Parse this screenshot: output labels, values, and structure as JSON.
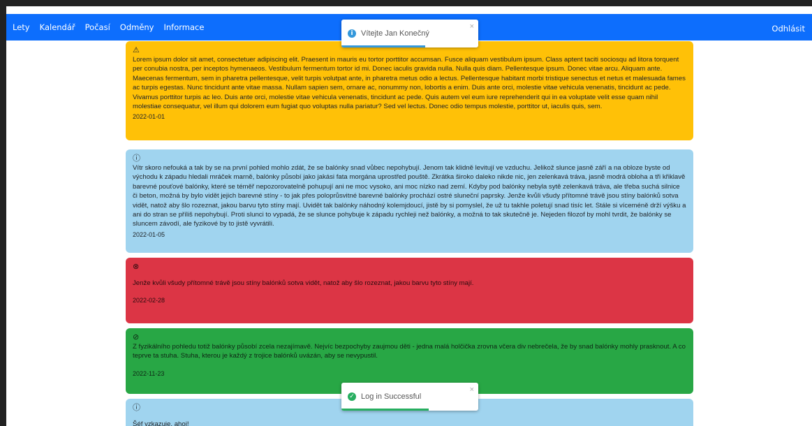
{
  "navbar": {
    "links": [
      "Lety",
      "Kalendář",
      "Počasí",
      "Odměny",
      "Informace"
    ],
    "logout": "Odhlásit",
    "bg": "#0d6efd"
  },
  "notices": [
    {
      "type": "warning",
      "icon": "⚠",
      "text": "Lorem ipsum dolor sit amet, consectetuer adipiscing elit. Praesent in mauris eu tortor porttitor accumsan. Fusce aliquam vestibulum ipsum. Class aptent taciti sociosqu ad litora torquent per conubia nostra, per inceptos hymenaeos. Vestibulum fermentum tortor id mi. Donec iaculis gravida nulla. Nulla quis diam. Pellentesque ipsum. Donec vitae arcu. Aliquam ante. Maecenas fermentum, sem in pharetra pellentesque, velit turpis volutpat ante, in pharetra metus odio a lectus. Pellentesque habitant morbi tristique senectus et netus et malesuada fames ac turpis egestas. Nunc tincidunt ante vitae massa. Nullam sapien sem, ornare ac, nonummy non, lobortis a enim. Duis ante orci, molestie vitae vehicula venenatis, tincidunt ac pede. Vivamus porttitor turpis ac leo. Duis ante orci, molestie vitae vehicula venenatis, tincidunt ac pede. Quis autem vel eum iure reprehenderit qui in ea voluptate velit esse quam nihil molestiae consequatur, vel illum qui dolorem eum fugiat quo voluptas nulla pariatur? Sed vel lectus. Donec odio tempus molestie, porttitor ut, iaculis quis, sem.",
      "date": "2022-01-01"
    },
    {
      "type": "info",
      "icon": "ⓘ",
      "text": "Vítr skoro nefouká a tak by se na první pohled mohlo zdát, že se balónky snad vůbec nepohybují. Jenom tak klidně levitují ve vzduchu. Jelikož slunce jasně září a na obloze byste od východu k západu hledali mráček marně, balónky působí jako jakási fata morgána uprostřed pouště. Zkrátka široko daleko nikde nic, jen zelenkavá tráva, jasně modrá obloha a tři křiklavě barevné pouťové balónky, které se téměř nepozorovatelně pohupují ani ne moc vysoko, ani moc nízko nad zemí. Kdyby pod balónky nebyla sytě zelenkavá tráva, ale třeba suchá silnice či beton, možná by bylo vidět jejich barevné stíny - to jak přes poloprůsvitné barevné balónky prochází ostré sluneční paprsky. Jenže kvůli všudy přítomné trávě jsou stíny balónků sotva vidět, natož aby šlo rozeznat, jakou barvu tyto stíny mají. Uvidět tak balónky náhodný kolemjdoucí, jistě by si pomyslel, že už tu takhle poletují snad tisíc let. Stále si víceméně drží výšku a ani do stran se příliš nepohybují. Proti slunci to vypadá, že se slunce pohybuje k západu rychleji než balónky, a možná to tak skutečně je. Nejeden filozof by mohl tvrdit, že balónky se sluncem závodí, ale fyzikové by to jistě vyvrátili.",
      "date": "2022-01-05"
    },
    {
      "type": "danger",
      "icon": "⊗",
      "text": "Jenže kvůli všudy přítomné trávě jsou stíny balónků sotva vidět, natož aby šlo rozeznat, jakou barvu tyto stíny mají.",
      "date": "2022-02-28"
    },
    {
      "type": "success",
      "icon": "⊘",
      "text": "Z fyzikálního pohledu totiž balónky působí zcela nezajímavě. Nejvíc bezpochyby zaujmou děti - jedna malá holčička zrovna včera div nebrečela, že by snad balónky mohly prasknout. A co teprve ta stuha. Stuha, kterou je každý z trojice balónků uvázán, aby se nevypustil.",
      "date": "2022-11-23"
    },
    {
      "type": "info",
      "icon": "ⓘ",
      "text": "Šéf vzkazuje, ahoj!",
      "date": ""
    }
  ],
  "toasts": [
    {
      "icon": "i",
      "message": "Vítejte Jan Konečný",
      "close": "×",
      "color": "#3498db"
    },
    {
      "icon": "✓",
      "message": "Log in Successful",
      "close": "×",
      "color": "#27ae60"
    }
  ]
}
